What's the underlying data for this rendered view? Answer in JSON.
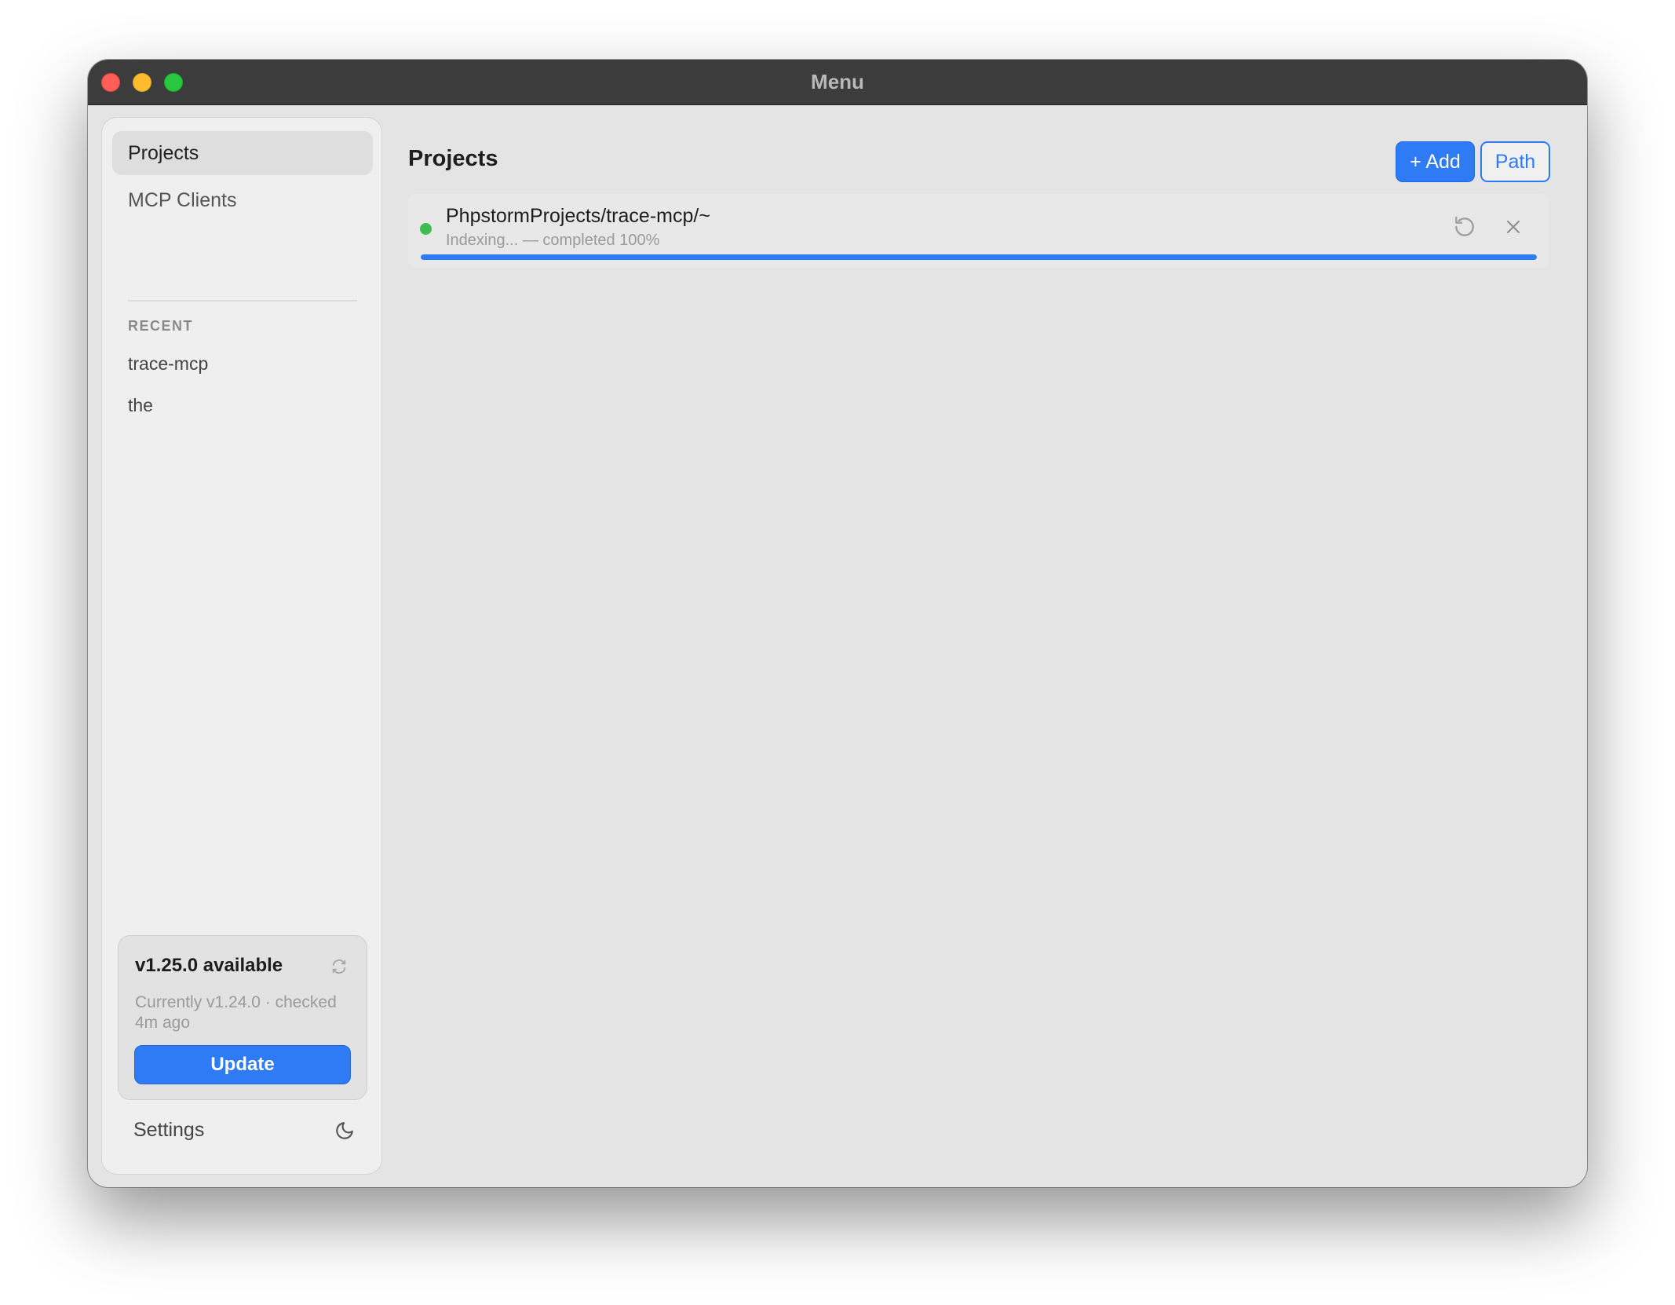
{
  "window": {
    "title": "Menu"
  },
  "sidebar": {
    "nav": [
      {
        "label": "Projects",
        "active": true
      },
      {
        "label": "MCP Clients",
        "active": false
      }
    ],
    "recent_label": "RECENT",
    "recent": [
      {
        "label": "trace-mcp"
      },
      {
        "label": "the"
      }
    ],
    "update": {
      "title": "v1.25.0 available",
      "subtitle": "Currently v1.24.0 · checked 4m ago",
      "button": "Update"
    },
    "settings_label": "Settings"
  },
  "main": {
    "title": "Projects",
    "add_button": "+ Add",
    "path_button": "Path",
    "projects": [
      {
        "name": "PhpstormProjects/trace-mcp/~",
        "status": "Indexing... — completed 100%",
        "progress_percent": 100,
        "status_color": "#3fbd53"
      }
    ]
  },
  "colors": {
    "accent": "#2f7af5",
    "status_ok": "#3fbd53"
  },
  "icons": [
    "refresh-icon",
    "moon-icon",
    "reindex-icon",
    "close-icon"
  ]
}
